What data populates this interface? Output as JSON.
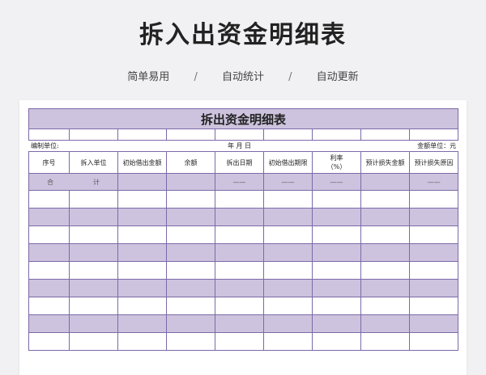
{
  "page": {
    "title": "拆入出资金明细表",
    "features": [
      "简单易用",
      "自动统计",
      "自动更新"
    ],
    "separator": "/"
  },
  "sheet": {
    "title": "拆出资金明细表",
    "info": {
      "unit_label": "编制单位:",
      "date_label": "年  月  日",
      "amount_unit_label": "金额单位：元"
    },
    "columns": [
      "序号",
      "拆入单位",
      "初始借出金额",
      "余额",
      "拆出日期",
      "初始借出期限",
      "利率\n（%）",
      "预计损失金额",
      "预计损失原因"
    ],
    "total": {
      "label_a": "合",
      "label_b": "计",
      "dash": "——"
    }
  }
}
